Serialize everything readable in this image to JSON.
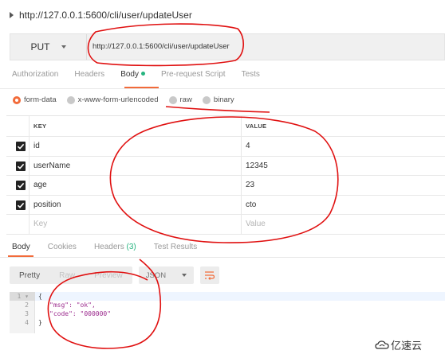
{
  "request": {
    "title": "http://127.0.0.1:5600/cli/user/updateUser",
    "method": "PUT",
    "url": "http://127.0.0.1:5600/cli/user/updateUser"
  },
  "request_tabs": [
    {
      "label": "Authorization"
    },
    {
      "label": "Headers"
    },
    {
      "label": "Body"
    },
    {
      "label": "Pre-request Script"
    },
    {
      "label": "Tests"
    }
  ],
  "body_types": [
    {
      "label": "form-data",
      "checked": true
    },
    {
      "label": "x-www-form-urlencoded",
      "checked": false
    },
    {
      "label": "raw",
      "checked": false
    },
    {
      "label": "binary",
      "checked": false
    }
  ],
  "params_table": {
    "key_header": "KEY",
    "value_header": "VALUE",
    "rows": [
      {
        "key": "id",
        "value": "4",
        "checked": true
      },
      {
        "key": "userName",
        "value": "12345",
        "checked": true
      },
      {
        "key": "age",
        "value": "23",
        "checked": true
      },
      {
        "key": "position",
        "value": "cto",
        "checked": true
      }
    ],
    "key_placeholder": "Key",
    "value_placeholder": "Value"
  },
  "response_tabs": [
    {
      "label": "Body"
    },
    {
      "label": "Cookies"
    },
    {
      "label": "Headers",
      "count": "(3)"
    },
    {
      "label": "Test Results"
    }
  ],
  "response_toolbar": {
    "views": [
      "Pretty",
      "Raw",
      "Preview"
    ],
    "format": "JSON"
  },
  "response_body": {
    "line_numbers": [
      "1",
      "2",
      "3",
      "4"
    ],
    "lines": [
      "{",
      "\"msg\": \"ok\",",
      "\"code\": \"000000\"",
      "}"
    ]
  },
  "watermark": "亿速云",
  "colors": {
    "accent": "#f26b3a",
    "active_dot": "#26b47f",
    "annotation": "#e01010"
  }
}
